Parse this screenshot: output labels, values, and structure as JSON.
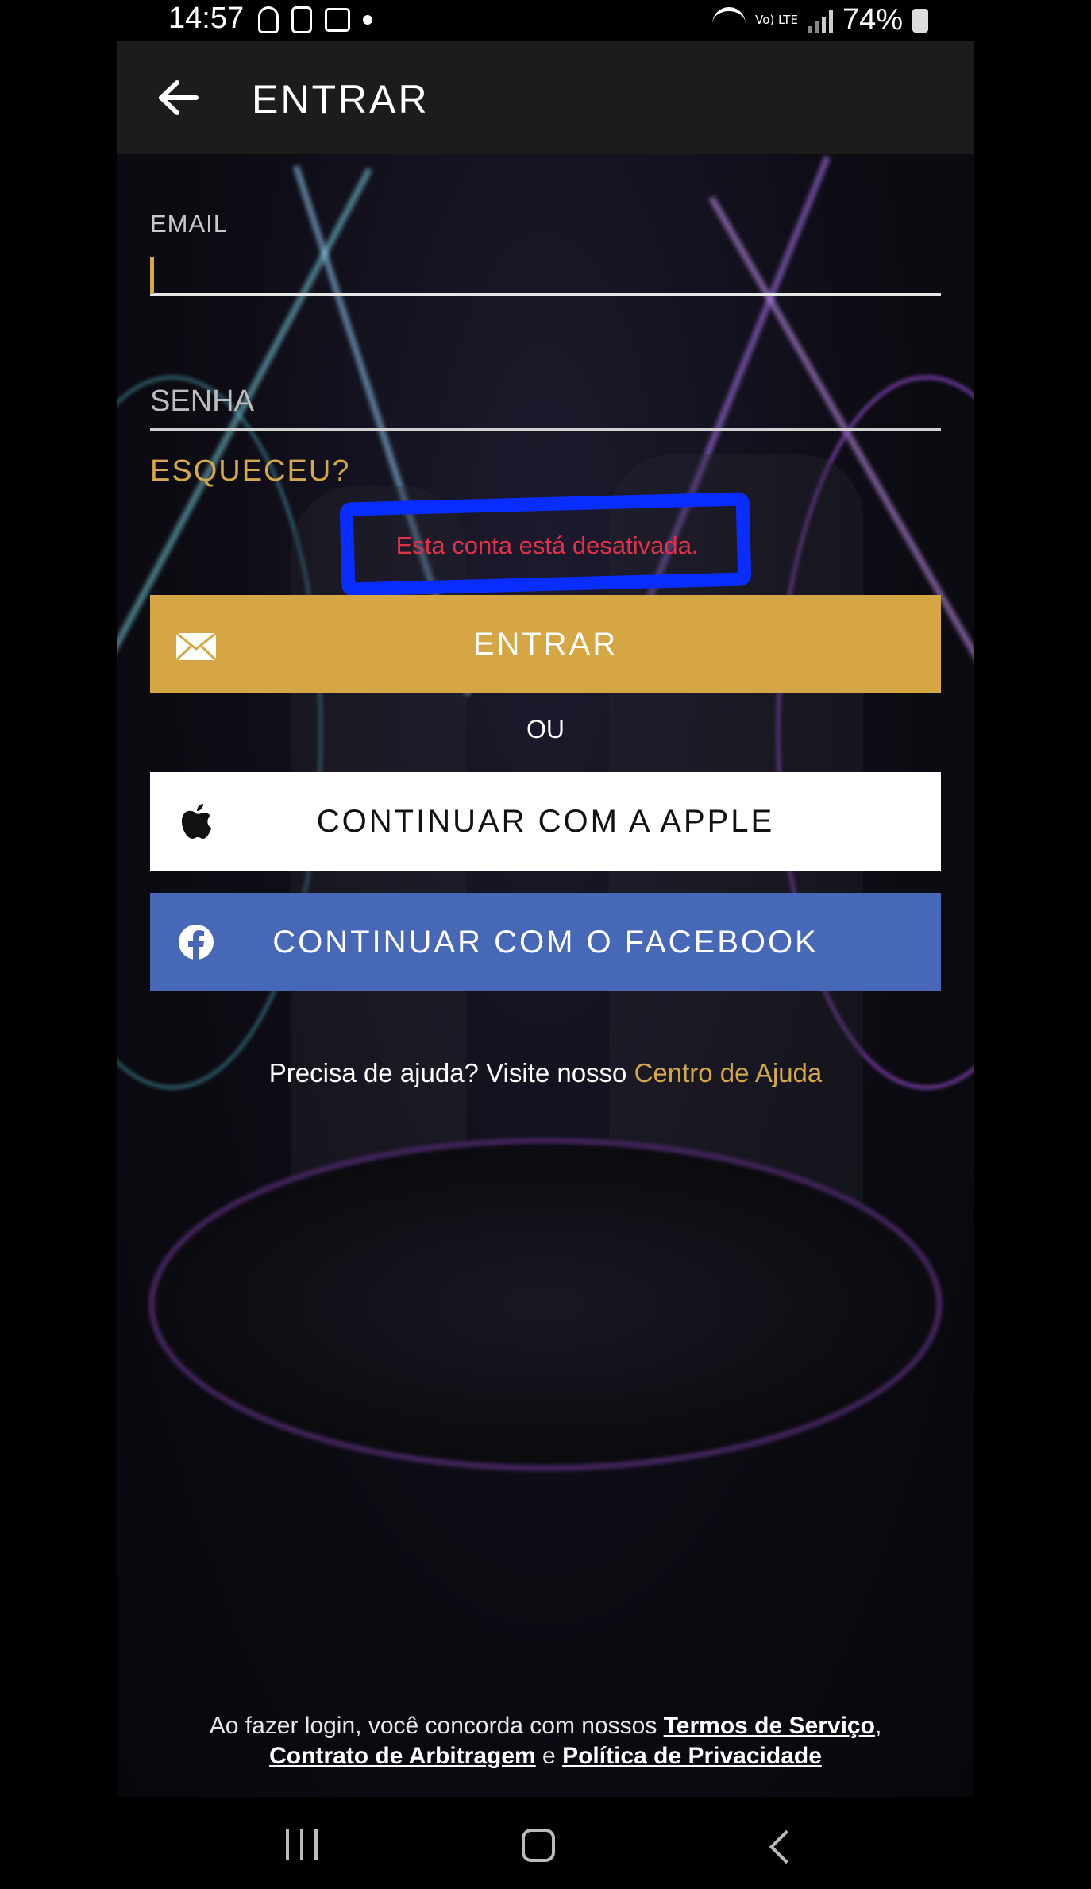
{
  "status_bar": {
    "time": "14:57",
    "battery": "74%",
    "network": "Vo) LTE",
    "icons": [
      "lightbulb-icon",
      "sim-icon",
      "image-icon",
      "dot-icon",
      "wifi-icon",
      "volte-icon",
      "signal-icon",
      "battery-icon"
    ]
  },
  "header": {
    "title": "ENTRAR",
    "back_icon": "arrow-left-icon"
  },
  "form": {
    "email_label": "EMAIL",
    "email_value": "",
    "password_placeholder": "SENHA",
    "forgot_label": "ESQUECEU?",
    "error_message": "Esta conta está desativada.",
    "error_highlight_color": "#0a2dff"
  },
  "buttons": {
    "email_login": {
      "label": "ENTRAR",
      "icon": "envelope-icon",
      "color": "#d6a645"
    },
    "or_text": "OU",
    "apple": {
      "label": "CONTINUAR COM A APPLE",
      "icon": "apple-icon",
      "color": "#ffffff"
    },
    "facebook": {
      "label": "CONTINUAR COM O FACEBOOK",
      "icon": "facebook-icon",
      "color": "#4668b6"
    }
  },
  "help": {
    "prefix": "Precisa de ajuda? Visite nosso",
    "link": "Centro de Ajuda"
  },
  "terms": {
    "prefix": "Ao fazer login, você concorda com nossos",
    "terms_link": "Termos de Serviço",
    "comma": ",",
    "arbitration_link": "Contrato de Arbitragem",
    "and": "e",
    "privacy_link": "Política de Privacidade"
  },
  "nav": {
    "recents_icon": "recents-icon",
    "home_icon": "home-icon",
    "back_icon": "nav-back-icon"
  },
  "colors": {
    "accent": "#d4a84b",
    "error": "#e0334a"
  }
}
